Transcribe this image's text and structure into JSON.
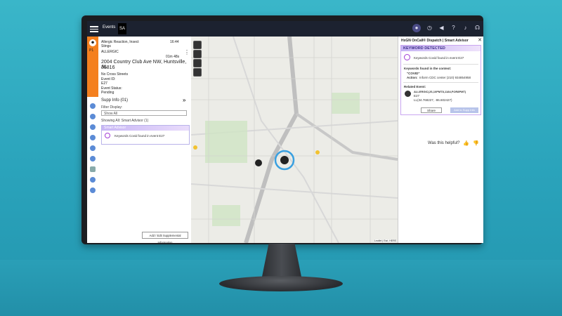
{
  "header": {
    "tab_events": "Events",
    "tab_sa": "SA"
  },
  "event": {
    "title_line1": "Allergic Reaction, Insect",
    "title_line2": "Stings",
    "code": "ALLERGIC",
    "time1": "16:44",
    "elapsed": "01m 48s",
    "address_line1": "2004 Country Club Ave NW, Huntsville, AL",
    "address_line2": "35816",
    "cross": "No Cross Streets",
    "id_label": "Event ID:",
    "id": "E27",
    "status_label": "Event Status:",
    "status": "Pending",
    "priority": "P1"
  },
  "supp": {
    "title": "Supp Info (01)",
    "filter_label": "Filter Display:",
    "filter_value": "Show All",
    "showing": "Showing All: Smart Advisor (1)",
    "card_head": "Smart Advisor",
    "card_text": "Keywords Covid found in event E27",
    "add_button": "Add / Edit Supplemental Information"
  },
  "map": {
    "copyright": "Leaflet | Esri, HERE"
  },
  "advisor": {
    "title": "HxGN OnCall® Dispatch | Smart Advisor",
    "close": "✕",
    "heading": "KEYWORD DETECTED",
    "keyword_msg": "Keywords Covid found in event E27",
    "context_label": "Keywords found in the context:",
    "context_value": "\"COVID\"",
    "action_label": "Action:",
    "action_value": "Inform CDC center (210) 934854958",
    "related_label": "Related Event:",
    "related_id": "ALLERGIC(JS,10PMT8,1184,FOR8PMT)",
    "related_ev": "E27",
    "related_coords": "LL(34.768227, -86.602427)",
    "share": "Share",
    "add_supp": "Add to Supp Info",
    "helpful": "Was this helpful?"
  },
  "colors": {
    "accent": "#f4801f",
    "advisor_purple": "#a23bd6",
    "topbar": "#1c2230"
  },
  "icons": [
    "menu-icon",
    "user-icon",
    "clock-icon",
    "megaphone-icon",
    "help-icon",
    "bell-icon",
    "headset-icon",
    "thumbs-up-icon",
    "thumbs-down-icon",
    "zoom-icon",
    "layers-icon",
    "filter-icon",
    "square-icon"
  ]
}
